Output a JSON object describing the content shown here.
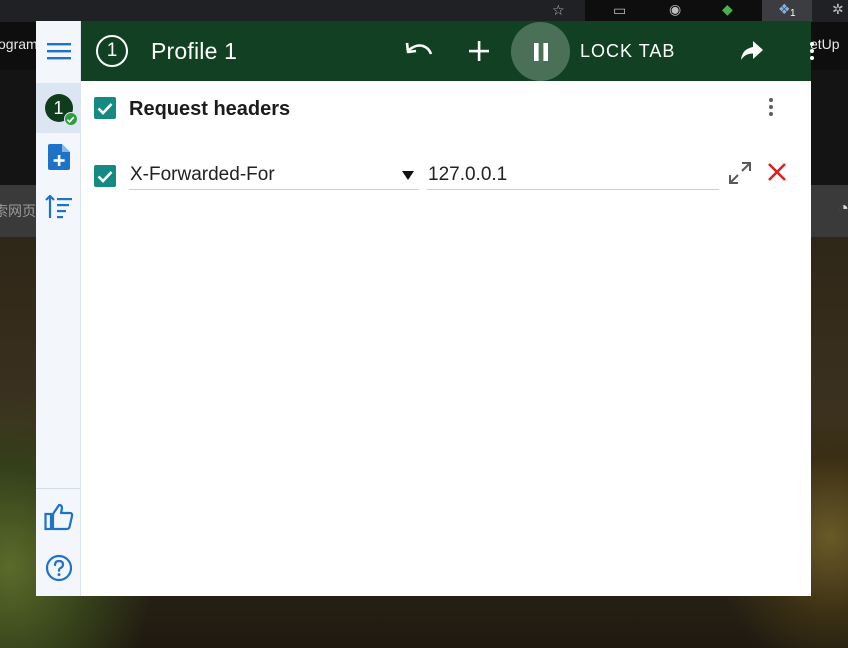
{
  "background": {
    "bookmark_left": "ogram",
    "bookmark_right": "etUp",
    "search_snippet": "索网页",
    "extension_badge": "1"
  },
  "header": {
    "profile_number": "1",
    "title": "Profile 1",
    "lock_tab_label": "LOCK TAB",
    "icons": {
      "undo": "undo-icon",
      "add": "plus-icon",
      "pause": "pause-icon",
      "share": "share-icon",
      "more": "more-vert-icon"
    }
  },
  "sidebar": {
    "profile_badge": "1",
    "items": [
      {
        "name": "menu",
        "icon": "hamburger-menu-icon"
      },
      {
        "name": "profile-1",
        "icon": "profile-avatar"
      },
      {
        "name": "add-profile",
        "icon": "note-add-icon"
      },
      {
        "name": "sort",
        "icon": "sort-icon"
      },
      {
        "name": "rate",
        "icon": "thumb-up-icon"
      },
      {
        "name": "help",
        "icon": "help-icon"
      }
    ]
  },
  "section": {
    "title": "Request headers",
    "checked": true
  },
  "headers": [
    {
      "name": "X-Forwarded-For",
      "value": "127.0.0.1",
      "enabled": true
    }
  ],
  "colors": {
    "header_bg": "#114122",
    "pause_button_bg": "#4a7158",
    "checkbox": "#158a83",
    "sidebar_icon": "#1e73c8",
    "delete": "#e02020",
    "sidebar_bg": "#f3f6fb",
    "sidebar_active": "#dce6f3"
  }
}
